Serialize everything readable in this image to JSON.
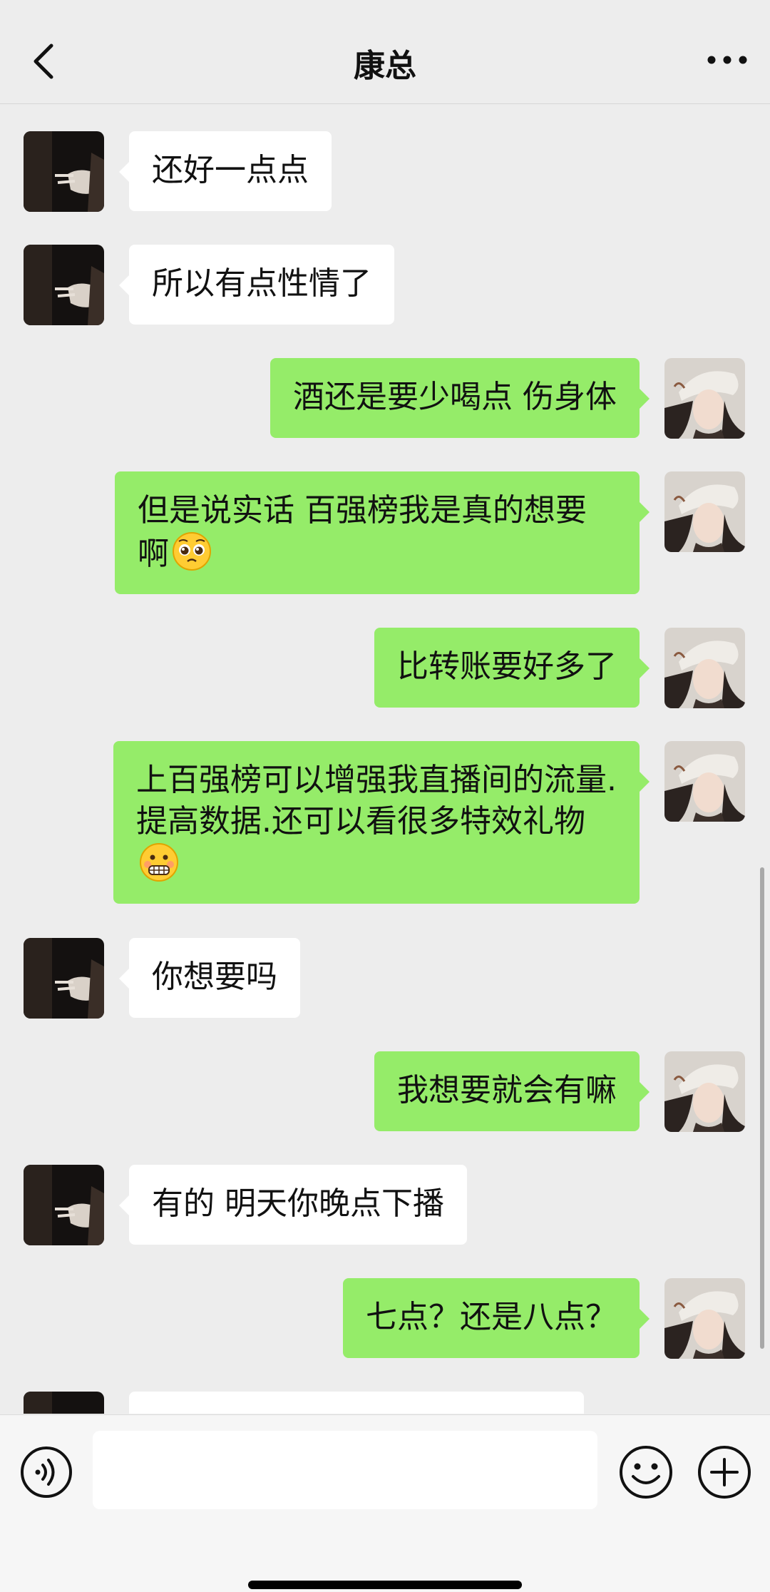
{
  "header": {
    "title": "康总",
    "back_icon": "chevron-left-icon",
    "more_icon": "more-dots-icon"
  },
  "messages": [
    {
      "side": "in",
      "text": "还好一点点"
    },
    {
      "side": "in",
      "text": "所以有点性情了"
    },
    {
      "side": "out",
      "text": "酒还是要少喝点  伤身体"
    },
    {
      "side": "out",
      "text": "但是说实话  百强榜我是真的想要啊",
      "emoji": "pleading-face-emoji"
    },
    {
      "side": "out",
      "text": "比转账要好多了"
    },
    {
      "side": "out",
      "text": "上百强榜可以增强我直播间的流量.提高数据.还可以看很多特效礼物",
      "emoji": "grimacing-face-emoji"
    },
    {
      "side": "in",
      "text": "你想要吗"
    },
    {
      "side": "out",
      "text": "我想要就会有嘛"
    },
    {
      "side": "in",
      "text": "有的  明天你晚点下播"
    },
    {
      "side": "out",
      "text": "七点？还是八点？"
    }
  ],
  "input_bar": {
    "voice_icon": "voice-icon",
    "input_value": "",
    "emoji_icon": "smiley-face-icon",
    "plus_icon": "plus-icon"
  },
  "colors": {
    "background": "#ededed",
    "outgoing_bubble": "#95ec69",
    "incoming_bubble": "#ffffff"
  }
}
